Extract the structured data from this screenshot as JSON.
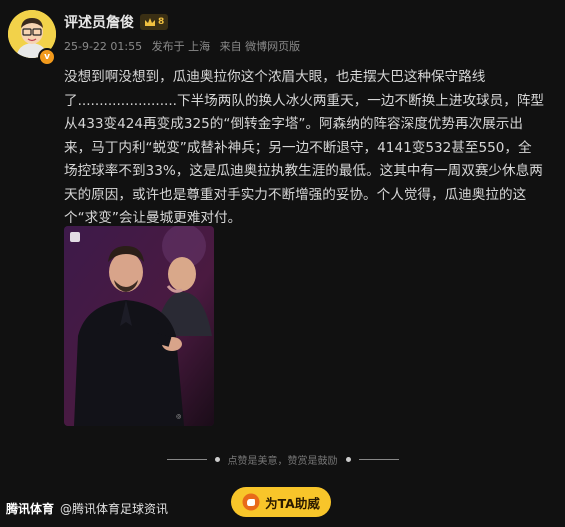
{
  "author": {
    "username": "评述员詹俊",
    "level": "8",
    "avatar_badge": "v"
  },
  "meta": {
    "datetime": "25-9-22 01:55",
    "location": "发布于 上海",
    "source": "来自 微博网页版"
  },
  "post": {
    "text": "没想到啊没想到，瓜迪奥拉你这个浓眉大眼，也走摆大巴这种保守路线了.......................下半场两队的换人冰火两重天，一边不断换上进攻球员，阵型从433变424再变成325的“倒转金字塔”。阿森纳的阵容深度优势再次展示出来，马丁内利“蜕变”成替补神兵；另一边不断退守，4141变532甚至550，全场控球率不到33%，这是瓜迪奥拉执教生涯的最低。这其中有一周双赛少休息两天的原因，或许也是尊重对手实力不断增强的妥协。个人觉得，瓜迪奥拉的这个“求变”会让曼城更难对付。"
  },
  "divider": {
    "text": "点赞是美意，赞赏是鼓励"
  },
  "boost_button": {
    "label": "为TA助威"
  },
  "footer": {
    "brand": "腾讯体育",
    "handle": "@腾讯体育足球资讯"
  },
  "colors": {
    "background": "#111111",
    "boost": "#f8c52a",
    "level_badge": "#f0c040"
  }
}
